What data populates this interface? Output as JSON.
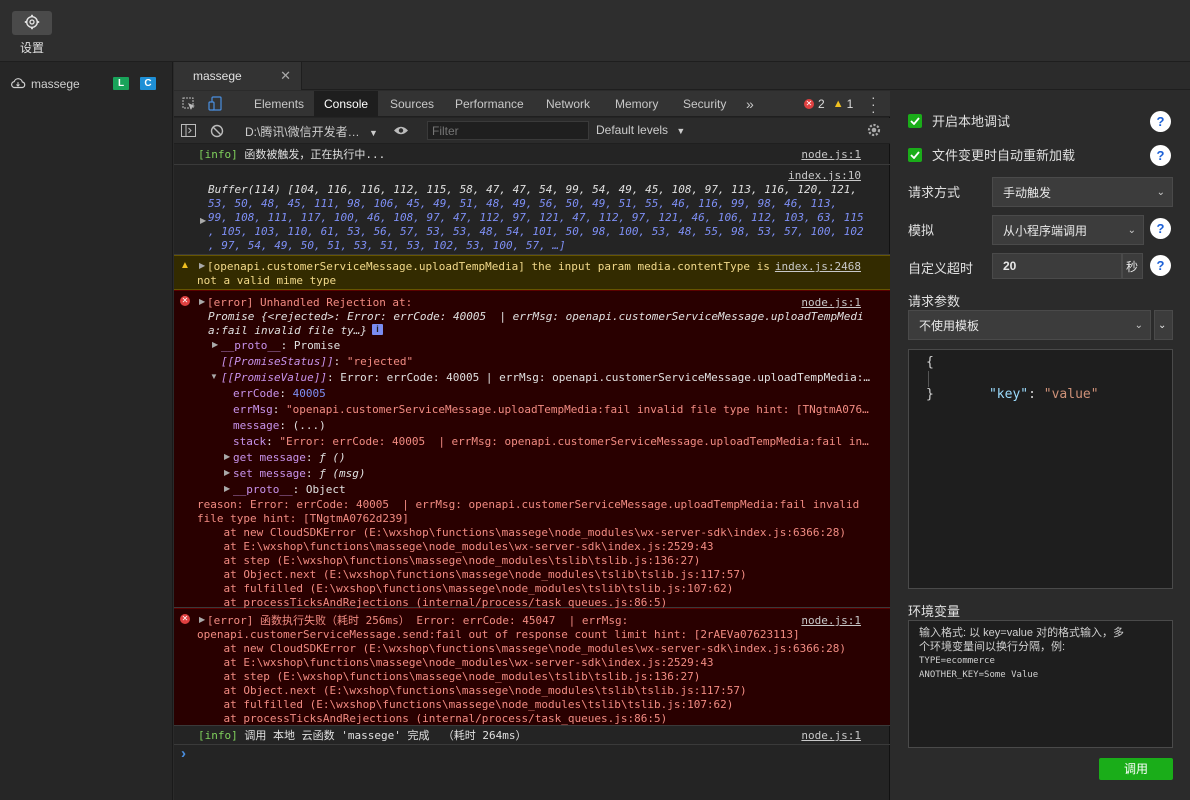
{
  "topbar": {
    "settings_label": "设置"
  },
  "left": {
    "function_name": "massege",
    "badge_l": "L",
    "badge_c": "C"
  },
  "editor": {
    "tab_label": "massege",
    "close": "✕"
  },
  "devtools": {
    "tabs": [
      "Elements",
      "Console",
      "Sources",
      "Performance",
      "Network",
      "Memory",
      "Security"
    ],
    "more": "»",
    "error_count": "2",
    "warn_count": "1",
    "context": "D:\\腾讯\\微信开发者…",
    "filter_placeholder": "Filter",
    "levels": "Default levels"
  },
  "console": {
    "info1": {
      "tag": "[info]",
      "text": " 函数被触发，正在执行中...",
      "src": "node.js:1"
    },
    "buffer": {
      "src": "index.js:10",
      "head": "Buffer(114) [",
      "lines": [
        "Buffer(114) [104, 116, 116, 112, 115, 58, 47, 47, 54, 99, 54, 49, 45, 108, 97, 113, 116, 120, 121,",
        "53, 50, 48, 45, 111, 98, 106, 45, 49, 51, 48, 49, 56, 50, 49, 51, 55, 46, 116, 99, 98, 46, 113,",
        "99, 108, 111, 117, 100, 46, 108, 97, 47, 112, 97, 121, 47, 112, 97, 121, 46, 106, 112, 103, 63, 115",
        ", 105, 103, 110, 61, 53, 56, 57, 53, 53, 48, 54, 101, 50, 98, 100, 53, 48, 55, 98, 53, 57, 100, 102",
        ", 97, 54, 49, 50, 51, 53, 51, 53, 102, 53, 100, 57, …]"
      ]
    },
    "warn": {
      "line1": "[openapi.customerServiceMessage.uploadTempMedia] the input param media.contentType is",
      "line2": "not a valid mime type",
      "src": "index.js:2468"
    },
    "err1": {
      "tag": "[error]",
      "title": " Unhandled Rejection at:",
      "src": "node.js:1",
      "promise1": "Promise {<rejected>: Error: errCode: 40005  | errMsg: openapi.customerServiceMessage.uploadTempMedi",
      "promise2": "a:fail invalid file ty…}",
      "proto1_key": "__proto__",
      "proto1_val": ": Promise",
      "status_key": "[[PromiseStatus]]",
      "status_val": "\"rejected\"",
      "value_key": "[[PromiseValue]]",
      "value_val": ": Error: errCode: 40005 | errMsg: openapi.customerServiceMessage.uploadTempMedia:…",
      "errcode_key": "errCode",
      "errcode_val": "40005",
      "errmsg_key": "errMsg",
      "errmsg_val": "\"openapi.customerServiceMessage.uploadTempMedia:fail invalid file type hint: [TNgtmA076…",
      "message_key": "message",
      "message_val": ": (...)",
      "stack_key": "stack",
      "stack_val": "\"Error: errCode: 40005  | errMsg: openapi.customerServiceMessage.uploadTempMedia:fail in…",
      "get_key": "get message",
      "get_val": "ƒ ()",
      "set_key": "set message",
      "set_val": "ƒ (msg)",
      "proto2_key": "__proto__",
      "proto2_val": ": Object",
      "reason1": "reason: Error: errCode: 40005  | errMsg: openapi.customerServiceMessage.uploadTempMedia:fail invalid",
      "reason2": "file type hint: [TNgtmA0762d239]",
      "stack": [
        "    at new CloudSDKError (E:\\wxshop\\functions\\massege\\node_modules\\wx-server-sdk\\index.js:6366:28)",
        "    at E:\\wxshop\\functions\\massege\\node_modules\\wx-server-sdk\\index.js:2529:43",
        "    at step (E:\\wxshop\\functions\\massege\\node_modules\\tslib\\tslib.js:136:27)",
        "    at Object.next (E:\\wxshop\\functions\\massege\\node_modules\\tslib\\tslib.js:117:57)",
        "    at fulfilled (E:\\wxshop\\functions\\massege\\node_modules\\tslib\\tslib.js:107:62)",
        "    at processTicksAndRejections (internal/process/task_queues.js:86:5)"
      ]
    },
    "err2": {
      "tag": "[error]",
      "title": " 函数执行失败（耗时 256ms） Error: errCode: 45047  | errMsg:",
      "src": "node.js:1",
      "line2": "openapi.customerServiceMessage.send:fail out of response count limit hint: [2rAEVa07623113]",
      "stack": [
        "    at new CloudSDKError (E:\\wxshop\\functions\\massege\\node_modules\\wx-server-sdk\\index.js:6366:28)",
        "    at E:\\wxshop\\functions\\massege\\node_modules\\wx-server-sdk\\index.js:2529:43",
        "    at step (E:\\wxshop\\functions\\massege\\node_modules\\tslib\\tslib.js:136:27)",
        "    at Object.next (E:\\wxshop\\functions\\massege\\node_modules\\tslib\\tslib.js:117:57)",
        "    at fulfilled (E:\\wxshop\\functions\\massege\\node_modules\\tslib\\tslib.js:107:62)",
        "    at processTicksAndRejections (internal/process/task_queues.js:86:5)"
      ]
    },
    "info2": {
      "tag": "[info]",
      "text": " 调用 本地 云函数 'massege' 完成  （耗时 264ms）",
      "src": "node.js:1"
    },
    "prompt": "›"
  },
  "right": {
    "local_debug": "开启本地调试",
    "auto_reload": "文件变更时自动重新加载",
    "request_mode_label": "请求方式",
    "request_mode_value": "手动触发",
    "simulate_label": "模拟",
    "simulate_value": "从小程序端调用",
    "timeout_label": "自定义超时",
    "timeout_value": "20",
    "timeout_unit": "秒",
    "params_label": "请求参数",
    "template_value": "不使用模板",
    "json": {
      "open": "{",
      "key": "\"key\"",
      "colon": ": ",
      "value": "\"value\"",
      "close": "}"
    },
    "env_label": "环境变量",
    "env_hint": [
      "输入格式: 以 key=value 对的格式输入，多",
      "个环境变量间以换行分隔，例:",
      "TYPE=ecommerce",
      "ANOTHER_KEY=Some Value"
    ],
    "run_button": "调用",
    "help": "?"
  },
  "colors": {
    "accent_green": "#1aad19",
    "error_bg": "#290000",
    "warn_bg": "#332b00"
  }
}
